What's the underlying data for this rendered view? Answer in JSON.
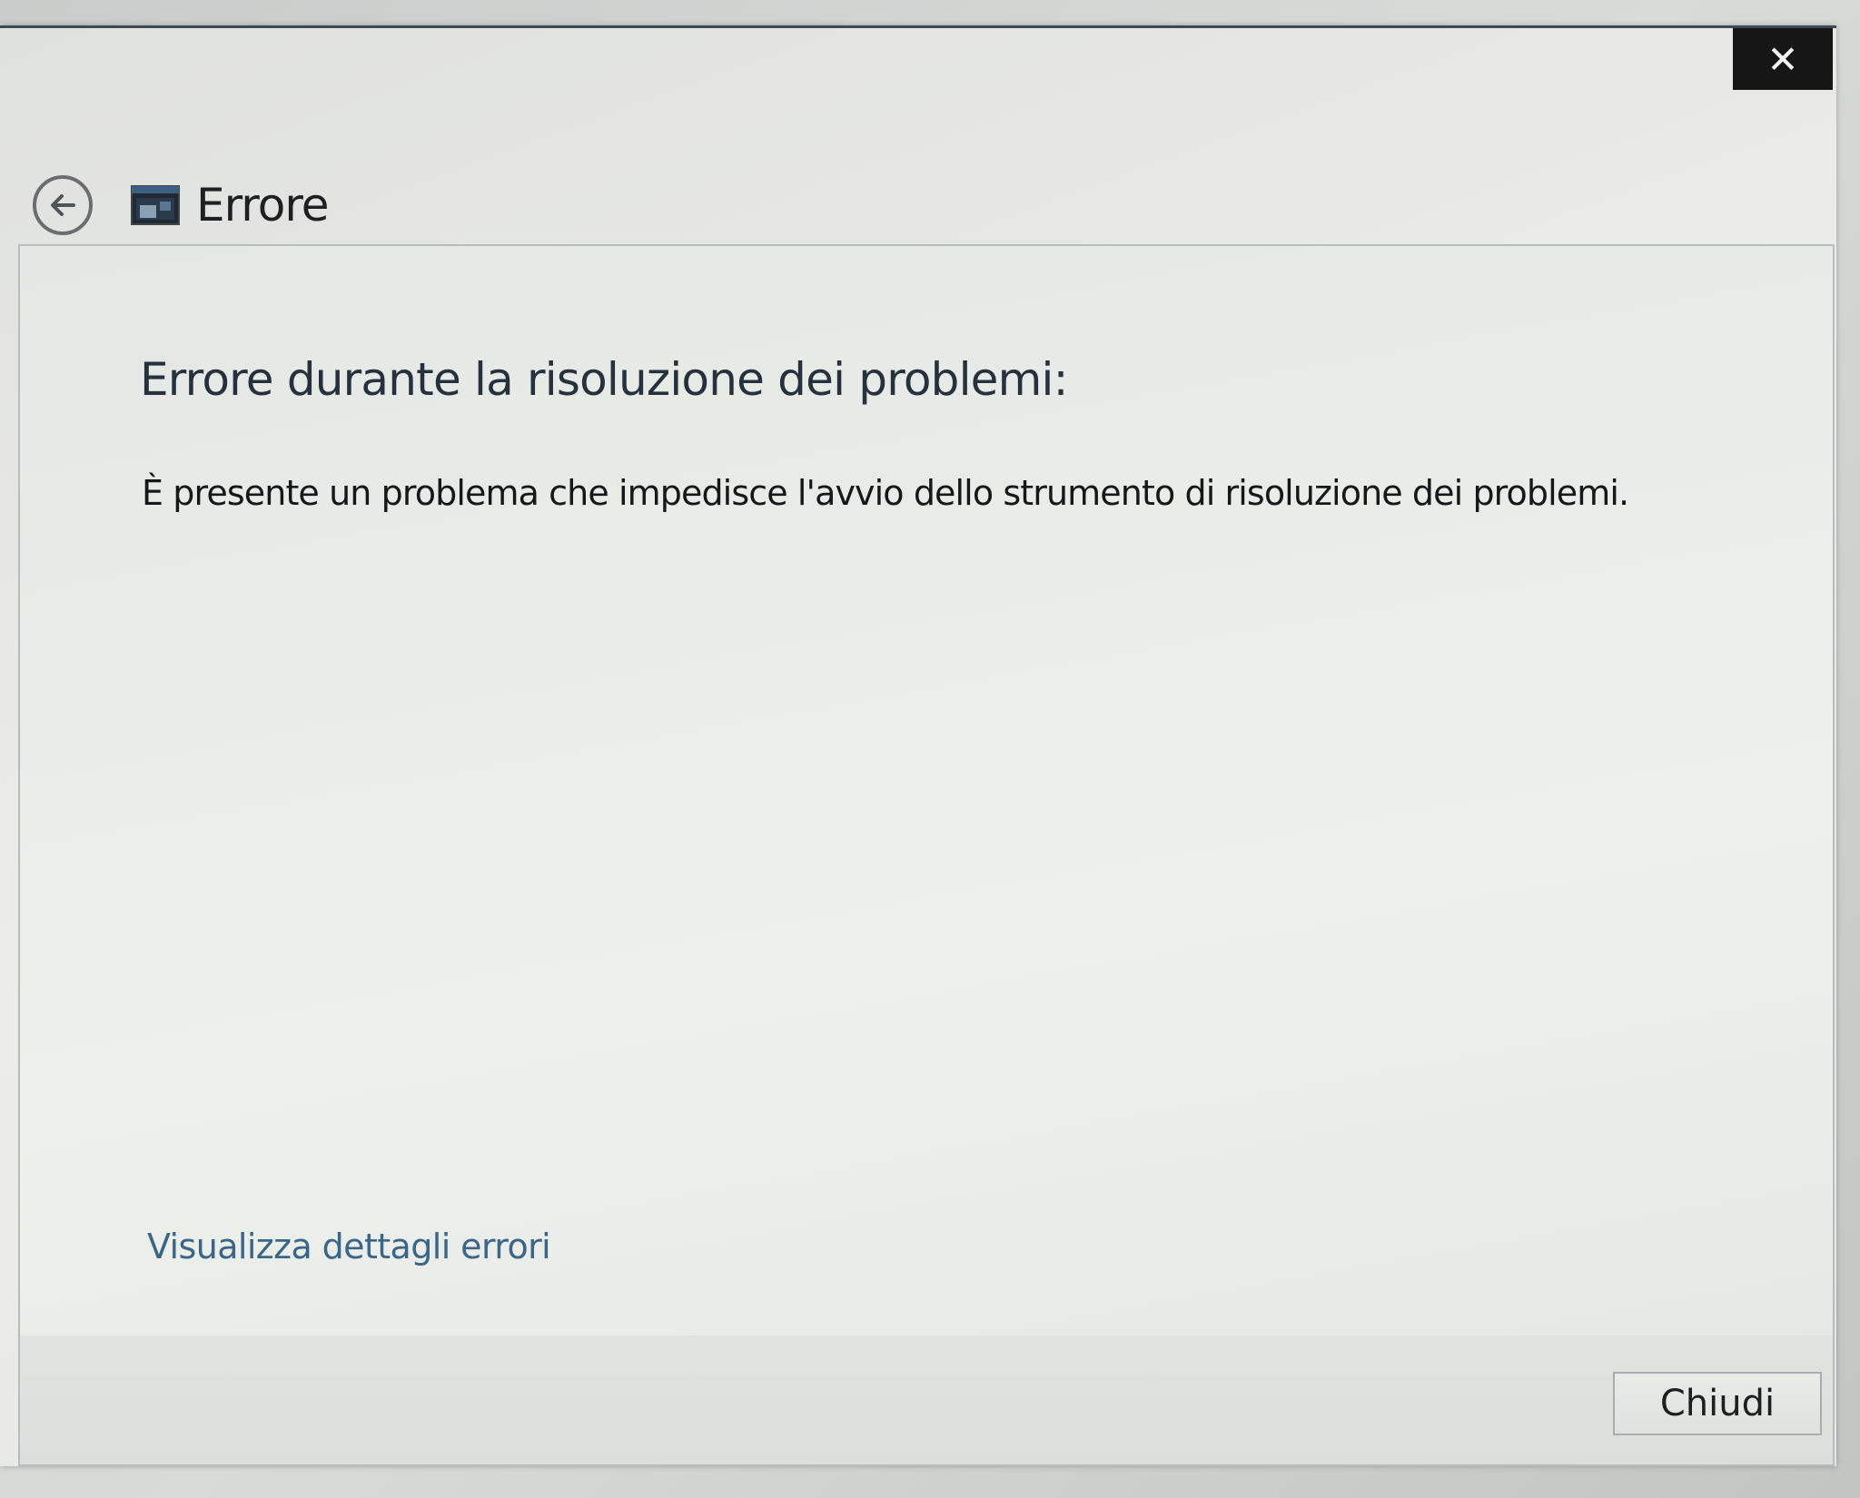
{
  "window": {
    "header_title": "Errore",
    "close_glyph": "✕"
  },
  "icons": {
    "back": "back-arrow-icon",
    "app": "troubleshooter-window-icon",
    "close": "close-icon"
  },
  "content": {
    "heading": "Errore durante la risoluzione dei problemi:",
    "message": "È presente un problema che impedisce l'avvio dello strumento di risoluzione dei problemi.",
    "details_link": "Visualizza dettagli errori"
  },
  "footer": {
    "close_button": "Chiudi"
  },
  "colors": {
    "link": "#3a6687",
    "heading": "#25323d",
    "close_bg": "#161616"
  }
}
